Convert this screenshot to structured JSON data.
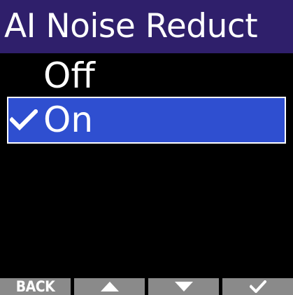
{
  "screen": {
    "title": "AI Noise Reduct"
  },
  "menu": {
    "options": [
      {
        "label": "Off",
        "selected": false
      },
      {
        "label": "On",
        "selected": true
      }
    ]
  },
  "footer": {
    "back_label": "BACK",
    "buttons": [
      {
        "icon": "up-arrow-icon"
      },
      {
        "icon": "down-arrow-icon"
      },
      {
        "icon": "check-icon"
      }
    ]
  },
  "colors": {
    "title_bg": "#2f1f6b",
    "selection_bg": "#2f4fd0",
    "footer_bg": "#8a8a8a"
  }
}
